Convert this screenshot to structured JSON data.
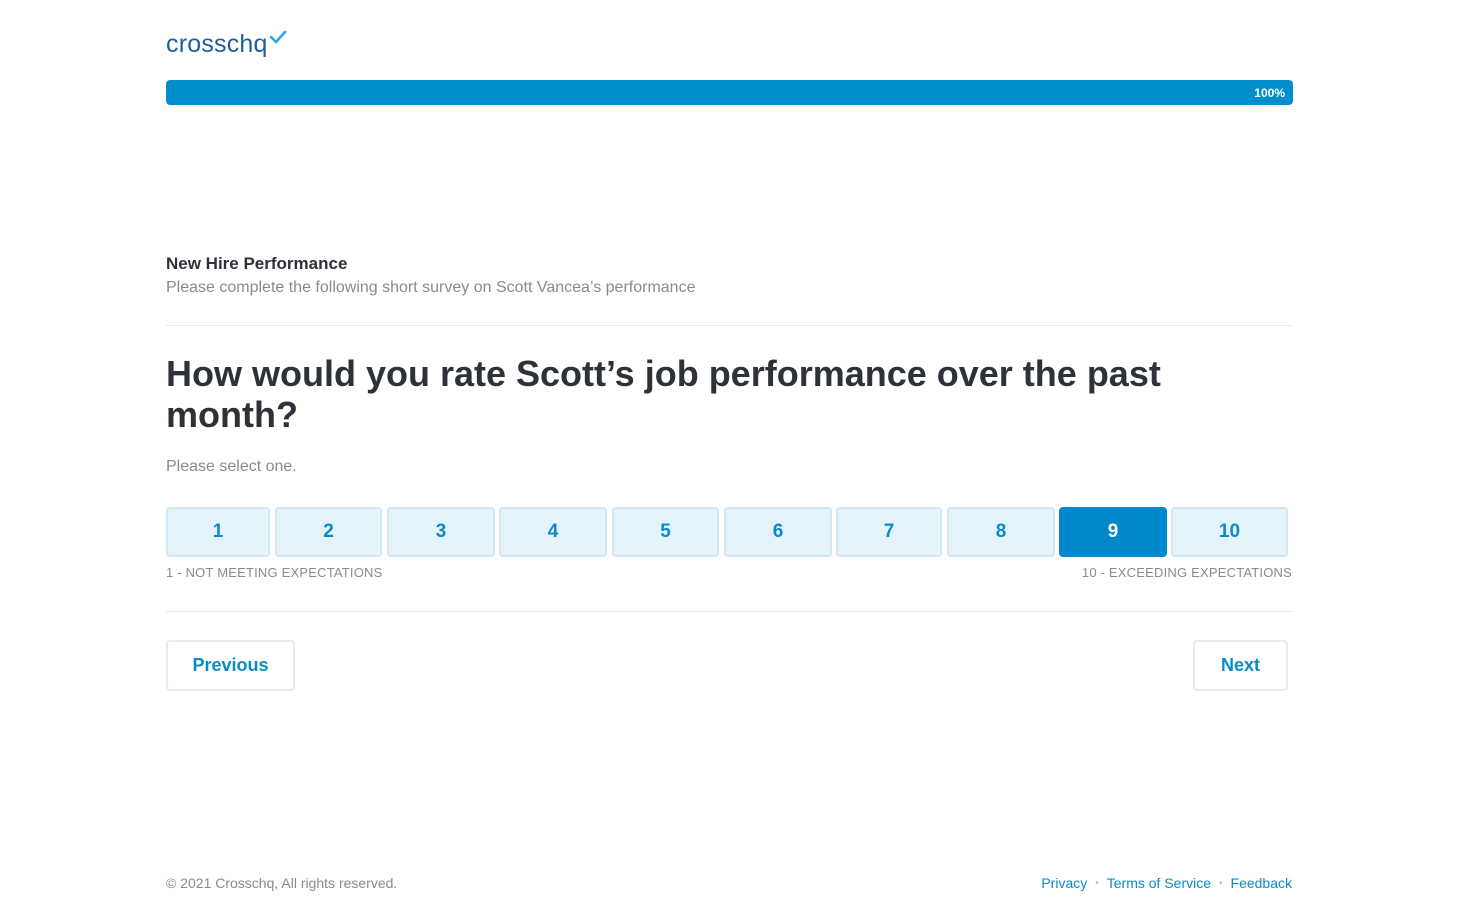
{
  "brand": {
    "logo_text": "crosschq",
    "logo_color": "#1f5f9b",
    "accent": "#0088cc"
  },
  "progress": {
    "label": "100%",
    "value_percent": 100
  },
  "survey": {
    "title": "New Hire Performance",
    "subtitle": "Please complete the following short survey on Scott Vancea’s performance"
  },
  "question": {
    "text": "How would you rate Scott’s job performance over the past month?",
    "instruction": "Please select one.",
    "options": [
      "1",
      "2",
      "3",
      "4",
      "5",
      "6",
      "7",
      "8",
      "9",
      "10"
    ],
    "selected": "9",
    "min_label": "1 - NOT MEETING EXPECTATIONS",
    "max_label": "10 - EXCEEDING EXPECTATIONS"
  },
  "nav": {
    "previous_label": "Previous",
    "next_label": "Next"
  },
  "footer": {
    "copyright": "© 2021 Crosschq, All rights reserved.",
    "links": [
      "Privacy",
      "Terms of Service",
      "Feedback"
    ]
  }
}
